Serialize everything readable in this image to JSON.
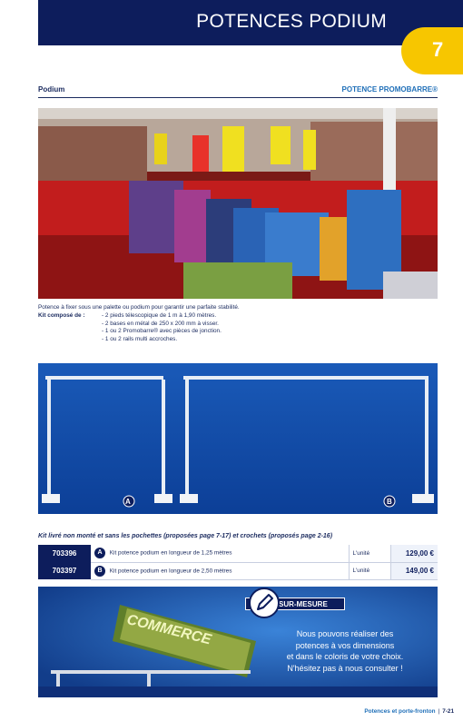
{
  "header": {
    "title": "POTENCES PODIUM",
    "page_number": "7"
  },
  "section": {
    "left": "Podium",
    "right": "POTENCE PROMOBARRE®"
  },
  "description": {
    "intro": "Potence à fixer sous une palette ou podium pour garantir une parfaite stabilité.",
    "kit_label": "Kit composé de :",
    "items": [
      "- 2 pieds télescopique de 1 m à 1,90 mètres.",
      "- 2 bases en métal de 250 x 200 mm à visser.",
      "- 1 ou 2 Promobarre® avec pièces de jonction.",
      "- 1 ou 2 rails multi accroches."
    ]
  },
  "product_labels": {
    "a": "A",
    "b": "B"
  },
  "kit_note": "Kit livré non monté et sans les pochettes (proposées page 7-17) et crochets (proposés page 2-16)",
  "prices": [
    {
      "ref": "703396",
      "badge": "A",
      "label": "Kit potence podium en longueur de 1,25 mètres",
      "unit": "L'unité",
      "price": "129,00 €"
    },
    {
      "ref": "703397",
      "badge": "B",
      "label": "Kit potence podium en longueur de 2,50 mètres",
      "unit": "L'unité",
      "price": "149,00 €"
    }
  ],
  "custom": {
    "badge": "LES SUR-MESURE",
    "lines": [
      "Nous pouvons réaliser des",
      "potences à vos dimensions",
      "et dans le coloris de votre choix.",
      "N'hésitez pas à nous consulter !"
    ],
    "banner_text": "COMMERCE"
  },
  "footer": {
    "section": "Potences et porte-fronton",
    "page": "7-21"
  },
  "colors": {
    "navy": "#0d1d5c",
    "yellow": "#f7c600",
    "blue": "#1f6fb8"
  }
}
